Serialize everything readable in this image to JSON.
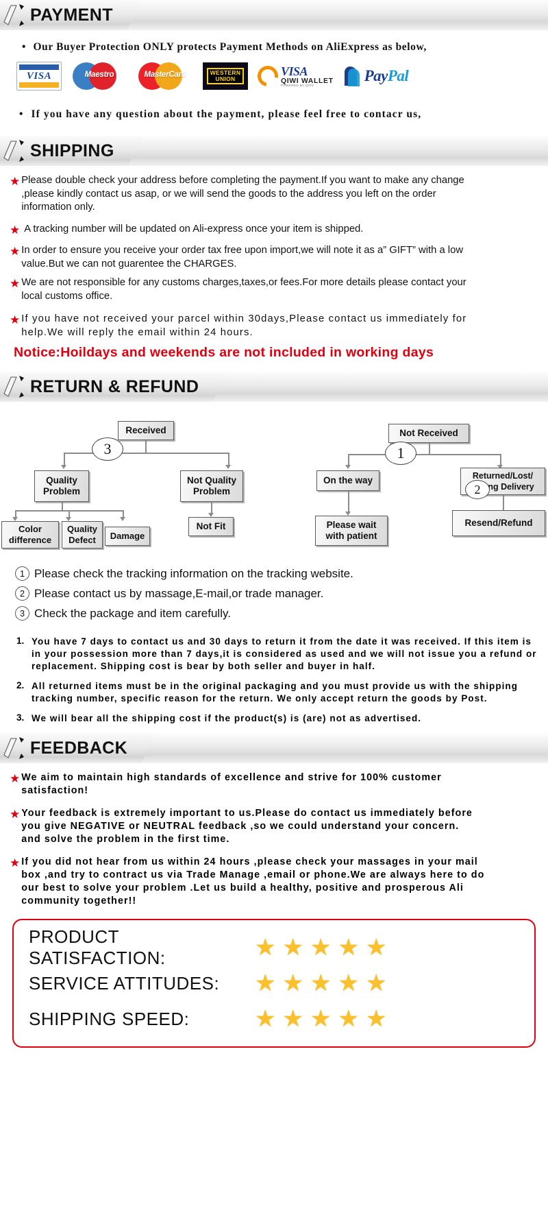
{
  "sections": {
    "payment": {
      "title": "PAYMENT",
      "line1": "Our Buyer Protection ONLY protects Payment Methods on AliExpress as below,",
      "line2": "If you have any question about the payment, please feel free to contacr us,",
      "logos": [
        {
          "name": "visa-logo",
          "label": "VISA"
        },
        {
          "name": "maestro-logo",
          "label": "Maestro"
        },
        {
          "name": "mastercard-logo",
          "label": "MasterCard"
        },
        {
          "name": "western-union-logo",
          "label": "WESTERN UNION"
        },
        {
          "name": "qiwi-wallet-logo",
          "label": "VISA QIWI WALLET"
        },
        {
          "name": "paypal-logo",
          "label": "PayPal"
        }
      ],
      "qiwi": {
        "visa": "VISA",
        "wallet": "QIWI WALLET",
        "powered": "POWERED BY QIPS"
      },
      "western_union": {
        "l1": "WESTERN",
        "l2": "UNION"
      },
      "paypal": {
        "pay": "Pay",
        "pal": "Pal"
      }
    },
    "shipping": {
      "title": "SHIPPING",
      "bullets": [
        "Please double check your address before completing the payment.If you want to make any change ,please kindly contact us asap, or we will send the goods to the address you left on the order information only.",
        "A tracking number will be updated on Ali-express once your item is shipped.",
        "In order to ensure you receive your order tax free upon import,we will note it as a” GIFT” with a low value.But we can not guarentee the CHARGES.",
        "We are not responsible for any customs charges,taxes,or fees.For more details please contact your local customs office.",
        "If you have not received your parcel within 30days,Please contact us immediately for help.We will reply the email within 24 hours."
      ],
      "notice": "Notice:Hoildays and weekends  are  not  included  in  working  days"
    },
    "return": {
      "title": "RETURN & REFUND",
      "flow": {
        "received": "Received",
        "quality_problem": "Quality\nProblem",
        "not_quality_problem": "Not Quality\nProblem",
        "color_difference": "Color\ndifference",
        "quality_defect": "Quality\nDefect",
        "damage": "Damage",
        "not_fit": "Not Fit",
        "not_received": "Not  Received",
        "on_the_way": "On the way",
        "returned_lost": "Returned/Lost/\nWrong Delivery",
        "please_wait": "Please wait\nwith patient",
        "resend_refund": "Resend/Refund",
        "badge1": "1",
        "badge2": "2",
        "badge3": "3"
      },
      "steps": [
        {
          "num": "①",
          "text": "Please check the tracking information on the tracking website."
        },
        {
          "num": "②",
          "text": "Please contact us by  massage,E-mail,or trade manager."
        },
        {
          "num": "③",
          "text": "Check the package and item carefully."
        }
      ],
      "policies": [
        {
          "num": "1.",
          "text": "You have 7 days to contact us and 30 days to return it from the date it was received. If this item is in your possession more than 7 days,it is considered as used and we will not issue you a refund or replacement. Shipping cost is bear by both seller and buyer in half."
        },
        {
          "num": "2.",
          "text": "All returned items must be in the original packaging and you must provide us with the shipping tracking number, specific reason for the return. We only accept return the goods by Post."
        },
        {
          "num": "3.",
          "text": "We will bear all the shipping cost if the product(s) is (are) not as advertised."
        }
      ]
    },
    "feedback": {
      "title": "FEEDBACK",
      "bullets": [
        "We aim to maintain high standards of excellence and strive  for 100% customer satisfaction!",
        "Your feedback is extremely important to us.Please do contact us immediately before you give NEGATIVE or NEUTRAL feedback ,so  we could understand your concern. and solve the problem in the first time.",
        "If you did not hear from us within 24 hours ,please check your massages in your mail box ,and try to contract us via Trade Manage ,email or phone.We are always here to do our best to solve your problem .Let us build a healthy, positive and prosperous Ali community together!!"
      ]
    },
    "satisfaction": {
      "rows": [
        {
          "label": "PRODUCT SATISFACTION:",
          "stars": 5
        },
        {
          "label": "SERVICE  ATTITUDES:",
          "stars": 5
        },
        {
          "label": "SHIPPING SPEED:",
          "stars": 5
        }
      ],
      "star_glyph": "★",
      "star_color": "#fbc02d",
      "border_color": "#e1000f"
    }
  },
  "colors": {
    "red": "#e1000f",
    "banner_grey": "#e6e6e6",
    "box_border": "#5a5a5a"
  }
}
